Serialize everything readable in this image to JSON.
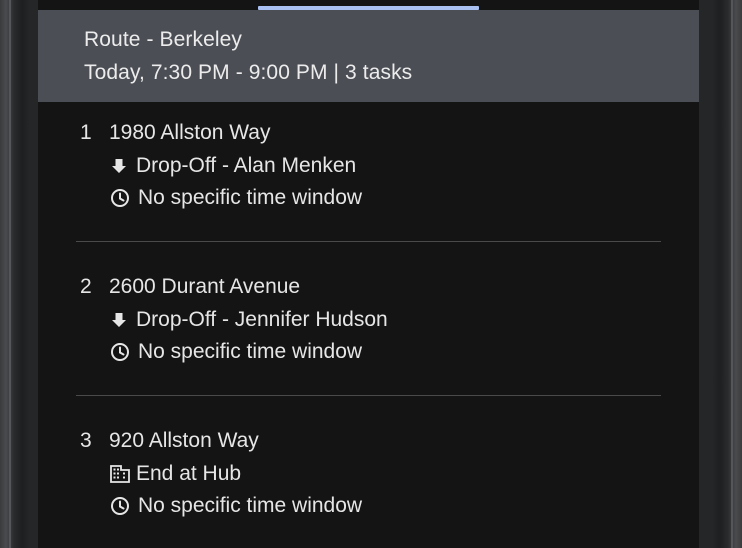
{
  "route": {
    "title": "Route - Berkeley",
    "subtitle": "Today, 7:30 PM - 9:00 PM | 3 tasks"
  },
  "stops": [
    {
      "number": "1",
      "address": "1980 Allston Way",
      "task_icon": "arrow-down-icon",
      "task_label": "Drop-Off - Alan Menken",
      "time_icon": "clock-icon",
      "time_label": "No specific time window"
    },
    {
      "number": "2",
      "address": "2600 Durant Avenue",
      "task_icon": "arrow-down-icon",
      "task_label": "Drop-Off - Jennifer Hudson",
      "time_icon": "clock-icon",
      "time_label": "No specific time window"
    },
    {
      "number": "3",
      "address": "920 Allston Way",
      "task_icon": "building-icon",
      "task_label": "End at Hub",
      "time_icon": "clock-icon",
      "time_label": "No specific time window"
    }
  ],
  "colors": {
    "header_bg": "#4b4e55",
    "screen_bg": "#141414",
    "handle": "#a8c0f2",
    "text": "#e6e6e6"
  }
}
